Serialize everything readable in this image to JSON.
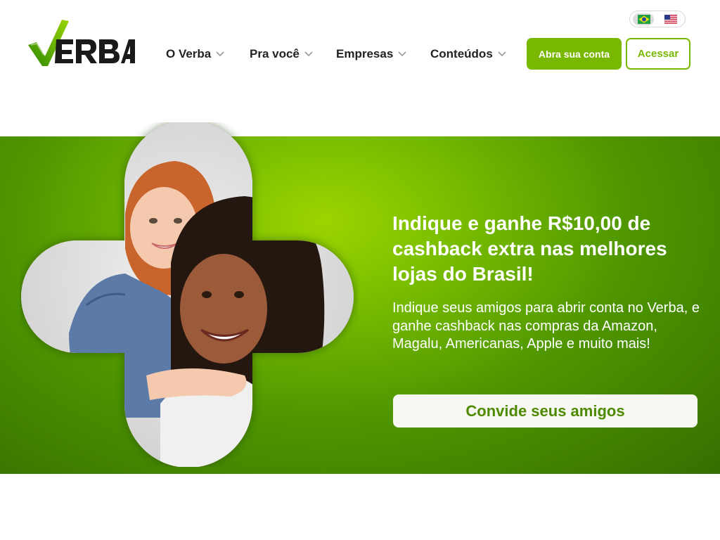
{
  "brand": {
    "name": "VERBA",
    "accent": "#79b800",
    "hero_gradient": [
      "#9cd400",
      "#7bbf00",
      "#4f9600",
      "#356f00"
    ]
  },
  "nav": {
    "items": [
      {
        "label": "O Verba",
        "icon": "chevron-down-icon"
      },
      {
        "label": "Pra você",
        "icon": "chevron-down-icon"
      },
      {
        "label": "Empresas",
        "icon": "chevron-down-icon"
      },
      {
        "label": "Conteúdos",
        "icon": "chevron-down-icon"
      }
    ]
  },
  "language": {
    "options": [
      {
        "flag": "brazil-flag-icon",
        "selected": true
      },
      {
        "flag": "usa-flag-icon",
        "selected": false
      }
    ]
  },
  "actions": {
    "open_account_label": "Abra sua conta",
    "login_label": "Acessar"
  },
  "hero": {
    "headline": "Indique e ganhe  R$10,00  de cashback extra nas melhores lojas do Brasil!",
    "subtext": "Indique  seus amigos  para abrir  conta  no Verba, e ganhe cashback nas compras da Amazon, Magalu, Americanas, Apple e muito mais!",
    "cta_label": "Convide seus amigos"
  }
}
